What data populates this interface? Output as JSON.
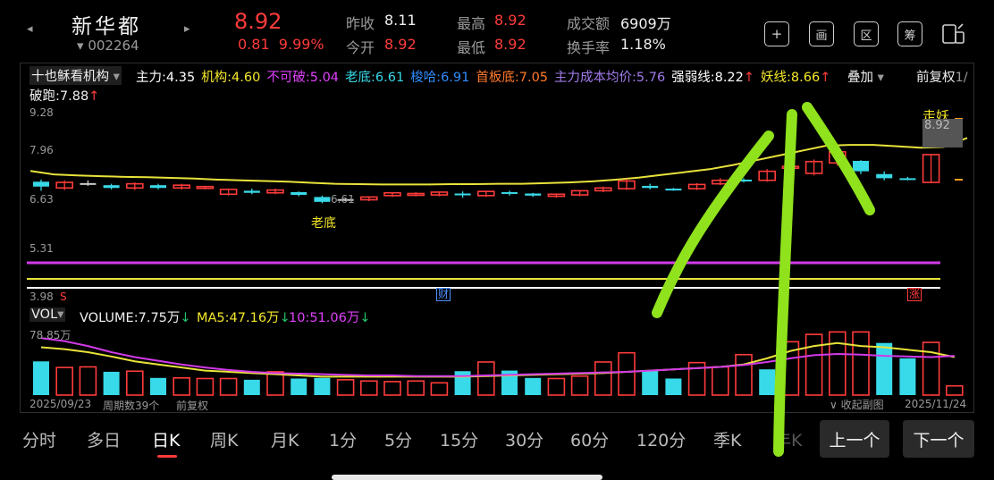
{
  "header": {
    "stock_name": "新华都",
    "stock_code": "002264",
    "price": "8.92",
    "change": "0.81",
    "change_pct": "9.99%",
    "prev_close_label": "昨收",
    "prev_close": "8.11",
    "open_label": "今开",
    "open": "8.92",
    "high_label": "最高",
    "high": "8.92",
    "low_label": "最低",
    "low": "8.92",
    "amount_label": "成交额",
    "amount": "6909万",
    "turnover_label": "换手率",
    "turnover": "1.18%",
    "icons": [
      "plus-square-icon",
      "draw-icon",
      "region-icon",
      "chips-icon",
      "window-icon"
    ],
    "icon_labels": [
      "+",
      "画",
      "区",
      "筹"
    ]
  },
  "indicator_bar": {
    "selector": "十也稣看机构",
    "items": [
      {
        "label": "主力:4.35",
        "color": "#ffffff"
      },
      {
        "label": "机构:4.60",
        "color": "#f5e82a"
      },
      {
        "label": "不可破:5.04",
        "color": "#e040fb"
      },
      {
        "label": "老底:6.61",
        "color": "#38d9e8"
      },
      {
        "label": "梭哈:6.91",
        "color": "#2f8dff"
      },
      {
        "label": "首板底:7.05",
        "color": "#ff7a2a"
      },
      {
        "label": "主力成本均价:5.76",
        "color": "#a07be8"
      },
      {
        "label": "强弱线:8.22",
        "color": "#ffffff"
      },
      {
        "label": "妖线:8.66",
        "color": "#f5e82a"
      }
    ],
    "overlay_label": "叠加",
    "restore_label": "前复权",
    "ratio_label": "1/",
    "line2": "破跑:7.88"
  },
  "price_axis": [
    "9.28",
    "7.96",
    "6.63",
    "5.31",
    "3.98"
  ],
  "annotations": {
    "laodi": "老底",
    "laodi_value": "6.61",
    "zouyao": "走妖",
    "last_price": "8.92",
    "cai": "财",
    "zhang": "涨",
    "s": "S"
  },
  "volume_bar": {
    "selector": "VOL",
    "volume": "VOLUME:7.75万",
    "ma5": "MA5:47.16万",
    "ma10": "10:51.06万",
    "axis_top": "78.85万"
  },
  "footer": {
    "start_date": "2025/09/23",
    "period_count": "周期数39个",
    "adjust": "前复权",
    "collapse": "收起副图",
    "end_date": "2025/11/24"
  },
  "bottom_tabs": [
    "分时",
    "多日",
    "日K",
    "周K",
    "月K",
    "1分",
    "5分",
    "15分",
    "30分",
    "60分",
    "120分",
    "季K",
    "年K"
  ],
  "nav_buttons": {
    "prev": "上一个",
    "next": "下一个"
  },
  "candles": [
    [
      7.1,
      7.24,
      6.98,
      7.3,
      0
    ],
    [
      7.22,
      7.06,
      7.0,
      7.28,
      1
    ],
    [
      7.18,
      7.2,
      7.12,
      7.28,
      2
    ],
    [
      7.14,
      7.06,
      7.02,
      7.18,
      0
    ],
    [
      7.06,
      7.18,
      7.0,
      7.22,
      1
    ],
    [
      7.14,
      7.06,
      7.02,
      7.18,
      0
    ],
    [
      7.14,
      7.06,
      7.02,
      7.18,
      1
    ],
    [
      7.1,
      7.06,
      7.02,
      7.12,
      1
    ],
    [
      6.88,
      7.02,
      6.84,
      7.04,
      1
    ],
    [
      6.98,
      6.92,
      6.88,
      7.04,
      0
    ],
    [
      6.92,
      7.0,
      6.88,
      7.04,
      1
    ],
    [
      6.86,
      6.94,
      6.82,
      6.96,
      0
    ],
    [
      6.66,
      6.8,
      6.62,
      6.84,
      0
    ],
    [
      6.74,
      6.74,
      6.68,
      6.78,
      2
    ],
    [
      6.72,
      6.8,
      6.68,
      6.82,
      1
    ],
    [
      6.84,
      6.92,
      6.8,
      6.94,
      1
    ],
    [
      6.86,
      6.9,
      6.82,
      6.94,
      1
    ],
    [
      6.86,
      6.94,
      6.82,
      6.96,
      1
    ],
    [
      6.88,
      6.9,
      6.78,
      6.96,
      0
    ],
    [
      6.84,
      6.96,
      6.8,
      6.98,
      1
    ],
    [
      6.9,
      6.94,
      6.84,
      6.98,
      0
    ],
    [
      6.84,
      6.9,
      6.8,
      6.92,
      0
    ],
    [
      6.82,
      6.88,
      6.78,
      6.9,
      1
    ],
    [
      6.86,
      6.98,
      6.82,
      7.0,
      1
    ],
    [
      6.98,
      7.06,
      6.94,
      7.1,
      1
    ],
    [
      7.04,
      7.26,
      7.0,
      7.32,
      1
    ],
    [
      7.12,
      7.06,
      7.02,
      7.18,
      0
    ],
    [
      7.0,
      7.04,
      6.98,
      7.06,
      0
    ],
    [
      7.04,
      7.16,
      7.0,
      7.2,
      1
    ],
    [
      7.18,
      7.28,
      7.14,
      7.34,
      1
    ],
    [
      7.28,
      7.3,
      7.22,
      7.34,
      0
    ],
    [
      7.28,
      7.54,
      7.24,
      7.6,
      1
    ],
    [
      7.64,
      7.68,
      7.58,
      7.84,
      1
    ],
    [
      7.48,
      7.82,
      7.42,
      7.88,
      1
    ],
    [
      8.1,
      7.78,
      7.7,
      8.16,
      1
    ],
    [
      7.84,
      7.54,
      7.46,
      7.86,
      0
    ],
    [
      7.46,
      7.34,
      7.28,
      7.54,
      0
    ],
    [
      7.34,
      7.34,
      7.28,
      7.38,
      0
    ],
    [
      7.22,
      8.02,
      7.2,
      8.02,
      1
    ]
  ],
  "volumes": [
    [
      55,
      0
    ],
    [
      45,
      1
    ],
    [
      46,
      1
    ],
    [
      38,
      0
    ],
    [
      39,
      1
    ],
    [
      28,
      0
    ],
    [
      28,
      1
    ],
    [
      27,
      1
    ],
    [
      27,
      1
    ],
    [
      25,
      0
    ],
    [
      38,
      1
    ],
    [
      27,
      0
    ],
    [
      28,
      0
    ],
    [
      25,
      1
    ],
    [
      23,
      1
    ],
    [
      22,
      1
    ],
    [
      23,
      1
    ],
    [
      20,
      1
    ],
    [
      39,
      0
    ],
    [
      54,
      1
    ],
    [
      40,
      0
    ],
    [
      28,
      0
    ],
    [
      27,
      1
    ],
    [
      31,
      1
    ],
    [
      54,
      1
    ],
    [
      69,
      1
    ],
    [
      40,
      0
    ],
    [
      27,
      0
    ],
    [
      53,
      1
    ],
    [
      46,
      1
    ],
    [
      66,
      1
    ],
    [
      42,
      0
    ],
    [
      87,
      1
    ],
    [
      99,
      1
    ],
    [
      103,
      1
    ],
    [
      103,
      1
    ],
    [
      85,
      0
    ],
    [
      60,
      0
    ],
    [
      86,
      1
    ],
    [
      15,
      1
    ]
  ],
  "yellow_line": [
    7.55,
    7.45,
    7.42,
    7.4,
    7.38,
    7.37,
    7.35,
    7.33,
    7.3,
    7.28,
    7.26,
    7.24,
    7.21,
    7.18,
    7.17,
    7.16,
    7.16,
    7.16,
    7.17,
    7.17,
    7.18,
    7.18,
    7.2,
    7.22,
    7.25,
    7.3,
    7.36,
    7.44,
    7.52,
    7.6,
    7.72,
    7.86,
    8.0,
    8.14,
    8.28,
    8.3,
    8.3,
    8.26,
    8.22,
    8.24,
    8.5
  ],
  "vol_ma_yellow": [
    78,
    75,
    70,
    63,
    55,
    50,
    45,
    40,
    38,
    36,
    34,
    32,
    30,
    30,
    30,
    30,
    30,
    30,
    30,
    31,
    32,
    33,
    34,
    35,
    36,
    38,
    40,
    42,
    44,
    46,
    50,
    60,
    72,
    80,
    85,
    80,
    78,
    74,
    70,
    62
  ],
  "vol_ma_purple": [
    93,
    88,
    80,
    70,
    62,
    56,
    50,
    45,
    41,
    38,
    36,
    35,
    34,
    33,
    32,
    32,
    31,
    31,
    31,
    32,
    33,
    34,
    35,
    36,
    37,
    38,
    40,
    42,
    44,
    46,
    49,
    54,
    60,
    65,
    67,
    66,
    64,
    63,
    62,
    64
  ]
}
